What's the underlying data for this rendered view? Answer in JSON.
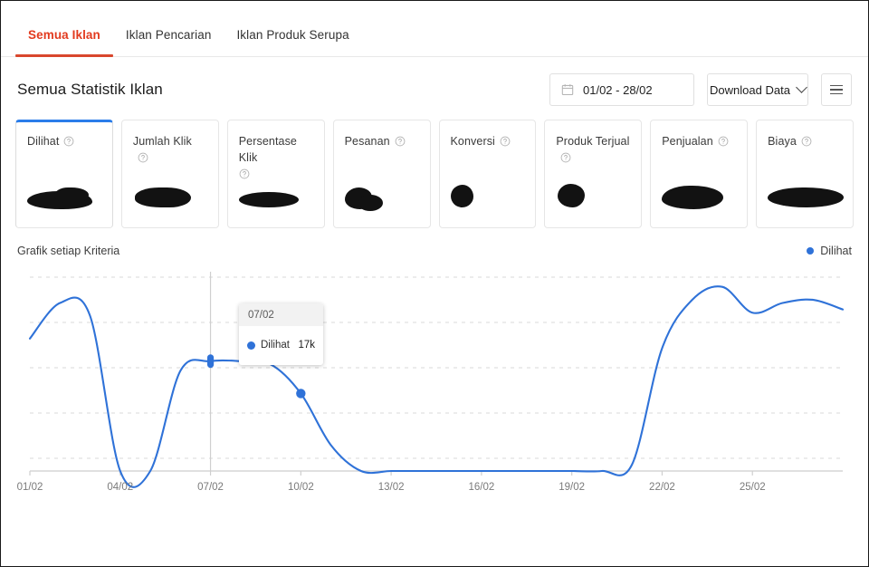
{
  "tabs": [
    {
      "label": "Semua Iklan",
      "active": true
    },
    {
      "label": "Iklan Pencarian",
      "active": false
    },
    {
      "label": "Iklan Produk Serupa",
      "active": false
    }
  ],
  "header": {
    "title": "Semua Statistik Iklan",
    "date_range": "01/02 - 28/02",
    "download_label": "Download Data",
    "calendar_icon": "calendar-icon",
    "chevron_icon": "chevron-down-icon",
    "menu_icon": "hamburger-menu-icon"
  },
  "cards": [
    {
      "label": "Dilihat",
      "value": "",
      "selected": true,
      "wrap": false
    },
    {
      "label": "Jumlah Klik",
      "value": "",
      "selected": false,
      "wrap": false
    },
    {
      "label": "Persentase Klik",
      "value": "",
      "selected": false,
      "wrap": true
    },
    {
      "label": "Pesanan",
      "value": "",
      "selected": false,
      "wrap": false
    },
    {
      "label": "Konversi",
      "value": "",
      "selected": false,
      "wrap": false
    },
    {
      "label": "Produk Terjual",
      "value": "",
      "selected": false,
      "wrap": false
    },
    {
      "label": "Penjualan",
      "value": "",
      "selected": false,
      "wrap": false
    },
    {
      "label": "Biaya",
      "value": "",
      "selected": false,
      "wrap": false
    }
  ],
  "chart_section": {
    "caption": "Grafik setiap Kriteria",
    "legend_label": "Dilihat"
  },
  "tooltip": {
    "date": "07/02",
    "series_label": "Dilihat",
    "value": "17k"
  },
  "colors": {
    "accent_tab": "#d9472d",
    "series_blue": "#2f72d8",
    "card_selected": "#2b7de9",
    "gridline": "#d8d8d8",
    "axis": "#d0d0d0"
  },
  "chart_data": {
    "type": "line",
    "title": "Grafik setiap Kriteria",
    "xlabel": "",
    "ylabel": "",
    "grid": true,
    "gridlines": 5,
    "legend_position": "top-right",
    "series": [
      {
        "name": "Dilihat",
        "color": "#2f72d8",
        "values": [
          20500,
          26000,
          24000,
          0,
          0,
          15500,
          17000,
          17000,
          16500,
          12000,
          4000,
          0,
          0,
          0,
          0,
          0,
          0,
          0,
          0,
          0,
          1000,
          19000,
          26500,
          28500,
          24500,
          26000,
          26500,
          25000
        ]
      }
    ],
    "categories": [
      "01/02",
      "02/02",
      "03/02",
      "04/02",
      "05/02",
      "06/02",
      "07/02",
      "08/02",
      "09/02",
      "10/02",
      "11/02",
      "12/02",
      "13/02",
      "14/02",
      "15/02",
      "16/02",
      "17/02",
      "18/02",
      "19/02",
      "20/02",
      "21/02",
      "22/02",
      "23/02",
      "24/02",
      "25/02",
      "26/02",
      "27/02",
      "28/02"
    ],
    "x_tick_labels": [
      "01/02",
      "04/02",
      "07/02",
      "10/02",
      "13/02",
      "16/02",
      "19/02",
      "22/02",
      "25/02"
    ],
    "ylim": [
      0,
      30000
    ],
    "highlighted_point": {
      "x_label": "07/02",
      "value": "17k"
    },
    "y_tick_labels": []
  }
}
